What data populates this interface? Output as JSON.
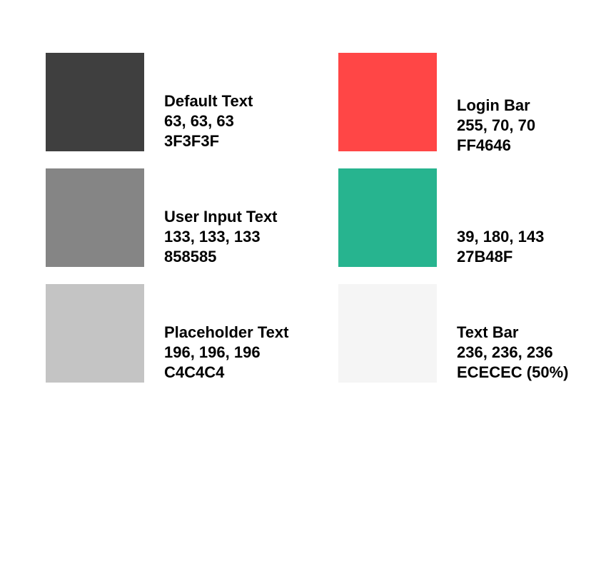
{
  "swatches": [
    {
      "name": "Default Text",
      "rgb": "63, 63, 63",
      "hex": "3F3F3F",
      "color": "#3F3F3F"
    },
    {
      "name": "User Input Text",
      "rgb": "133, 133, 133",
      "hex": "858585",
      "color": "#858585"
    },
    {
      "name": "Placeholder Text",
      "rgb": "196, 196, 196",
      "hex": "C4C4C4",
      "color": "#C4C4C4"
    },
    {
      "name": "Login Bar",
      "rgb": "255, 70, 70",
      "hex": "FF4646",
      "color": "#FF4646"
    },
    {
      "name": "",
      "rgb": "39, 180, 143",
      "hex": "27B48F",
      "color": "#27B48F"
    },
    {
      "name": "Text Bar",
      "rgb": "236, 236, 236",
      "hex": "ECECEC (50%)",
      "color": "#F5F5F5"
    }
  ]
}
